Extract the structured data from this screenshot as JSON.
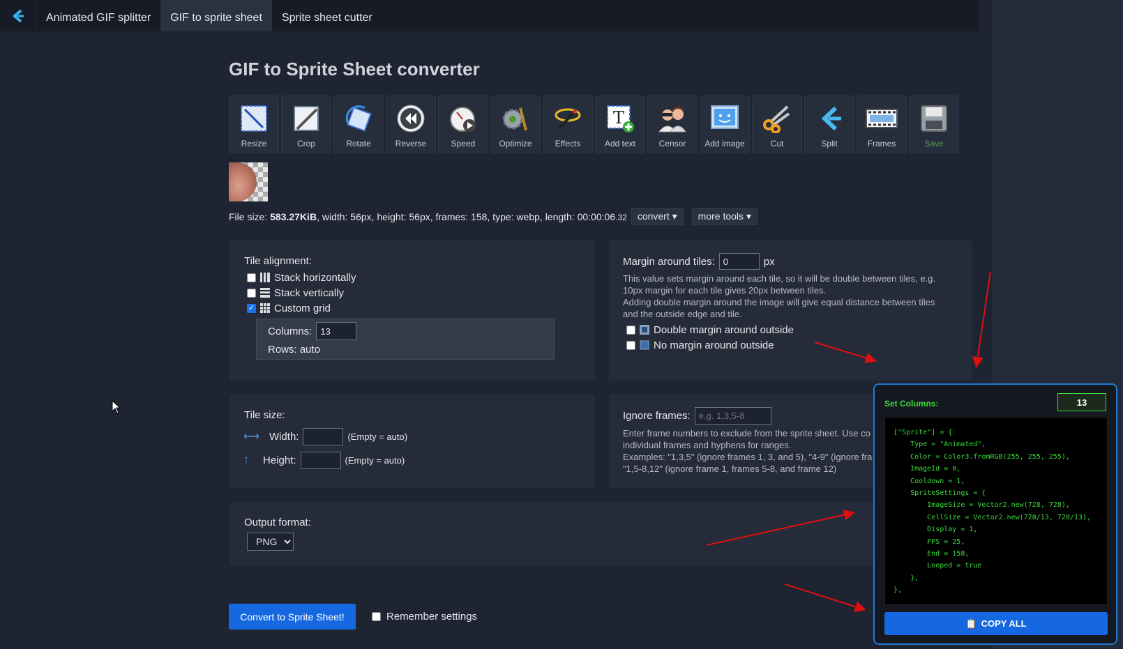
{
  "tabs": [
    "Animated GIF splitter",
    "GIF to sprite sheet",
    "Sprite sheet cutter"
  ],
  "active_tab": 1,
  "page_title": "GIF to Sprite Sheet converter",
  "tools": [
    {
      "label": "Resize",
      "icon": "resize-icon"
    },
    {
      "label": "Crop",
      "icon": "crop-icon"
    },
    {
      "label": "Rotate",
      "icon": "rotate-icon"
    },
    {
      "label": "Reverse",
      "icon": "reverse-icon"
    },
    {
      "label": "Speed",
      "icon": "speed-icon"
    },
    {
      "label": "Optimize",
      "icon": "optimize-icon"
    },
    {
      "label": "Effects",
      "icon": "effects-icon"
    },
    {
      "label": "Add text",
      "icon": "add-text-icon"
    },
    {
      "label": "Censor",
      "icon": "censor-icon"
    },
    {
      "label": "Add image",
      "icon": "add-image-icon"
    },
    {
      "label": "Cut",
      "icon": "scissors-icon"
    },
    {
      "label": "Split",
      "icon": "split-icon"
    },
    {
      "label": "Frames",
      "icon": "frames-icon"
    },
    {
      "label": "Save",
      "icon": "save-icon"
    }
  ],
  "fileinfo": {
    "size_label": "File size:",
    "size_value": "583.27KiB",
    "rest": ", width: 56px, height: 56px, frames: 158, type: webp, length: 00:00:06",
    "length_fraction": ".32",
    "convert_label": "convert",
    "more_tools_label": "more tools"
  },
  "alignment": {
    "label": "Tile alignment:",
    "stack_h": "Stack horizontally",
    "stack_v": "Stack vertically",
    "custom": "Custom grid",
    "columns_label": "Columns:",
    "columns_value": "13",
    "rows_label": "Rows: auto"
  },
  "margin": {
    "label": "Margin around tiles:",
    "value": "0",
    "unit": "px",
    "desc1": "This value sets margin around each tile, so it will be double between tiles, e.g.",
    "desc2": "10px margin for each tile gives 20px between tiles.",
    "desc3": "Adding double margin around the image will give equal distance between tiles",
    "desc4": "and the outside edge and tile.",
    "double_label": "Double margin around outside",
    "none_label": "No margin around outside"
  },
  "tilesize": {
    "label": "Tile size:",
    "width_label": "Width:",
    "height_label": "Height:",
    "hint": "(Empty = auto)"
  },
  "ignore": {
    "label": "Ignore frames:",
    "placeholder": "e.g. 1,3,5-8",
    "desc1": "Enter frame numbers to exclude from the sprite sheet. Use co",
    "desc2": "individual frames and hyphens for ranges.",
    "desc3": "Examples: \"1,3,5\" (ignore frames 1, 3, and 5), \"4-9\" (ignore fra",
    "desc4": "\"1,5-8,12\" (ignore frame 1, frames 5-8, and frame 12)"
  },
  "output": {
    "label": "Output format:",
    "value": "PNG"
  },
  "convert_button": "Convert to Sprite Sheet!",
  "remember_label": "Remember settings",
  "popup": {
    "title": "Set Columns:",
    "columns": "13",
    "code": "[\"Sprite\"] = {\n    Type = \"Animated\",\n    Color = Color3.fromRGB(255, 255, 255),\n    ImageId = 0,\n    Cooldown = 1,\n    SpriteSettings = {\n        ImageSize = Vector2.new(728, 728),\n        CellSize = Vector2.new(728/13, 728/13),\n        Display = 1,\n        FPS = 25,\n        End = 158,\n        Looped = true\n    },\n},",
    "copy_label": "COPY ALL"
  },
  "colors": {
    "accent": "#1668e0",
    "code_green": "#3ddc3d",
    "arrow_red": "#e01010"
  }
}
